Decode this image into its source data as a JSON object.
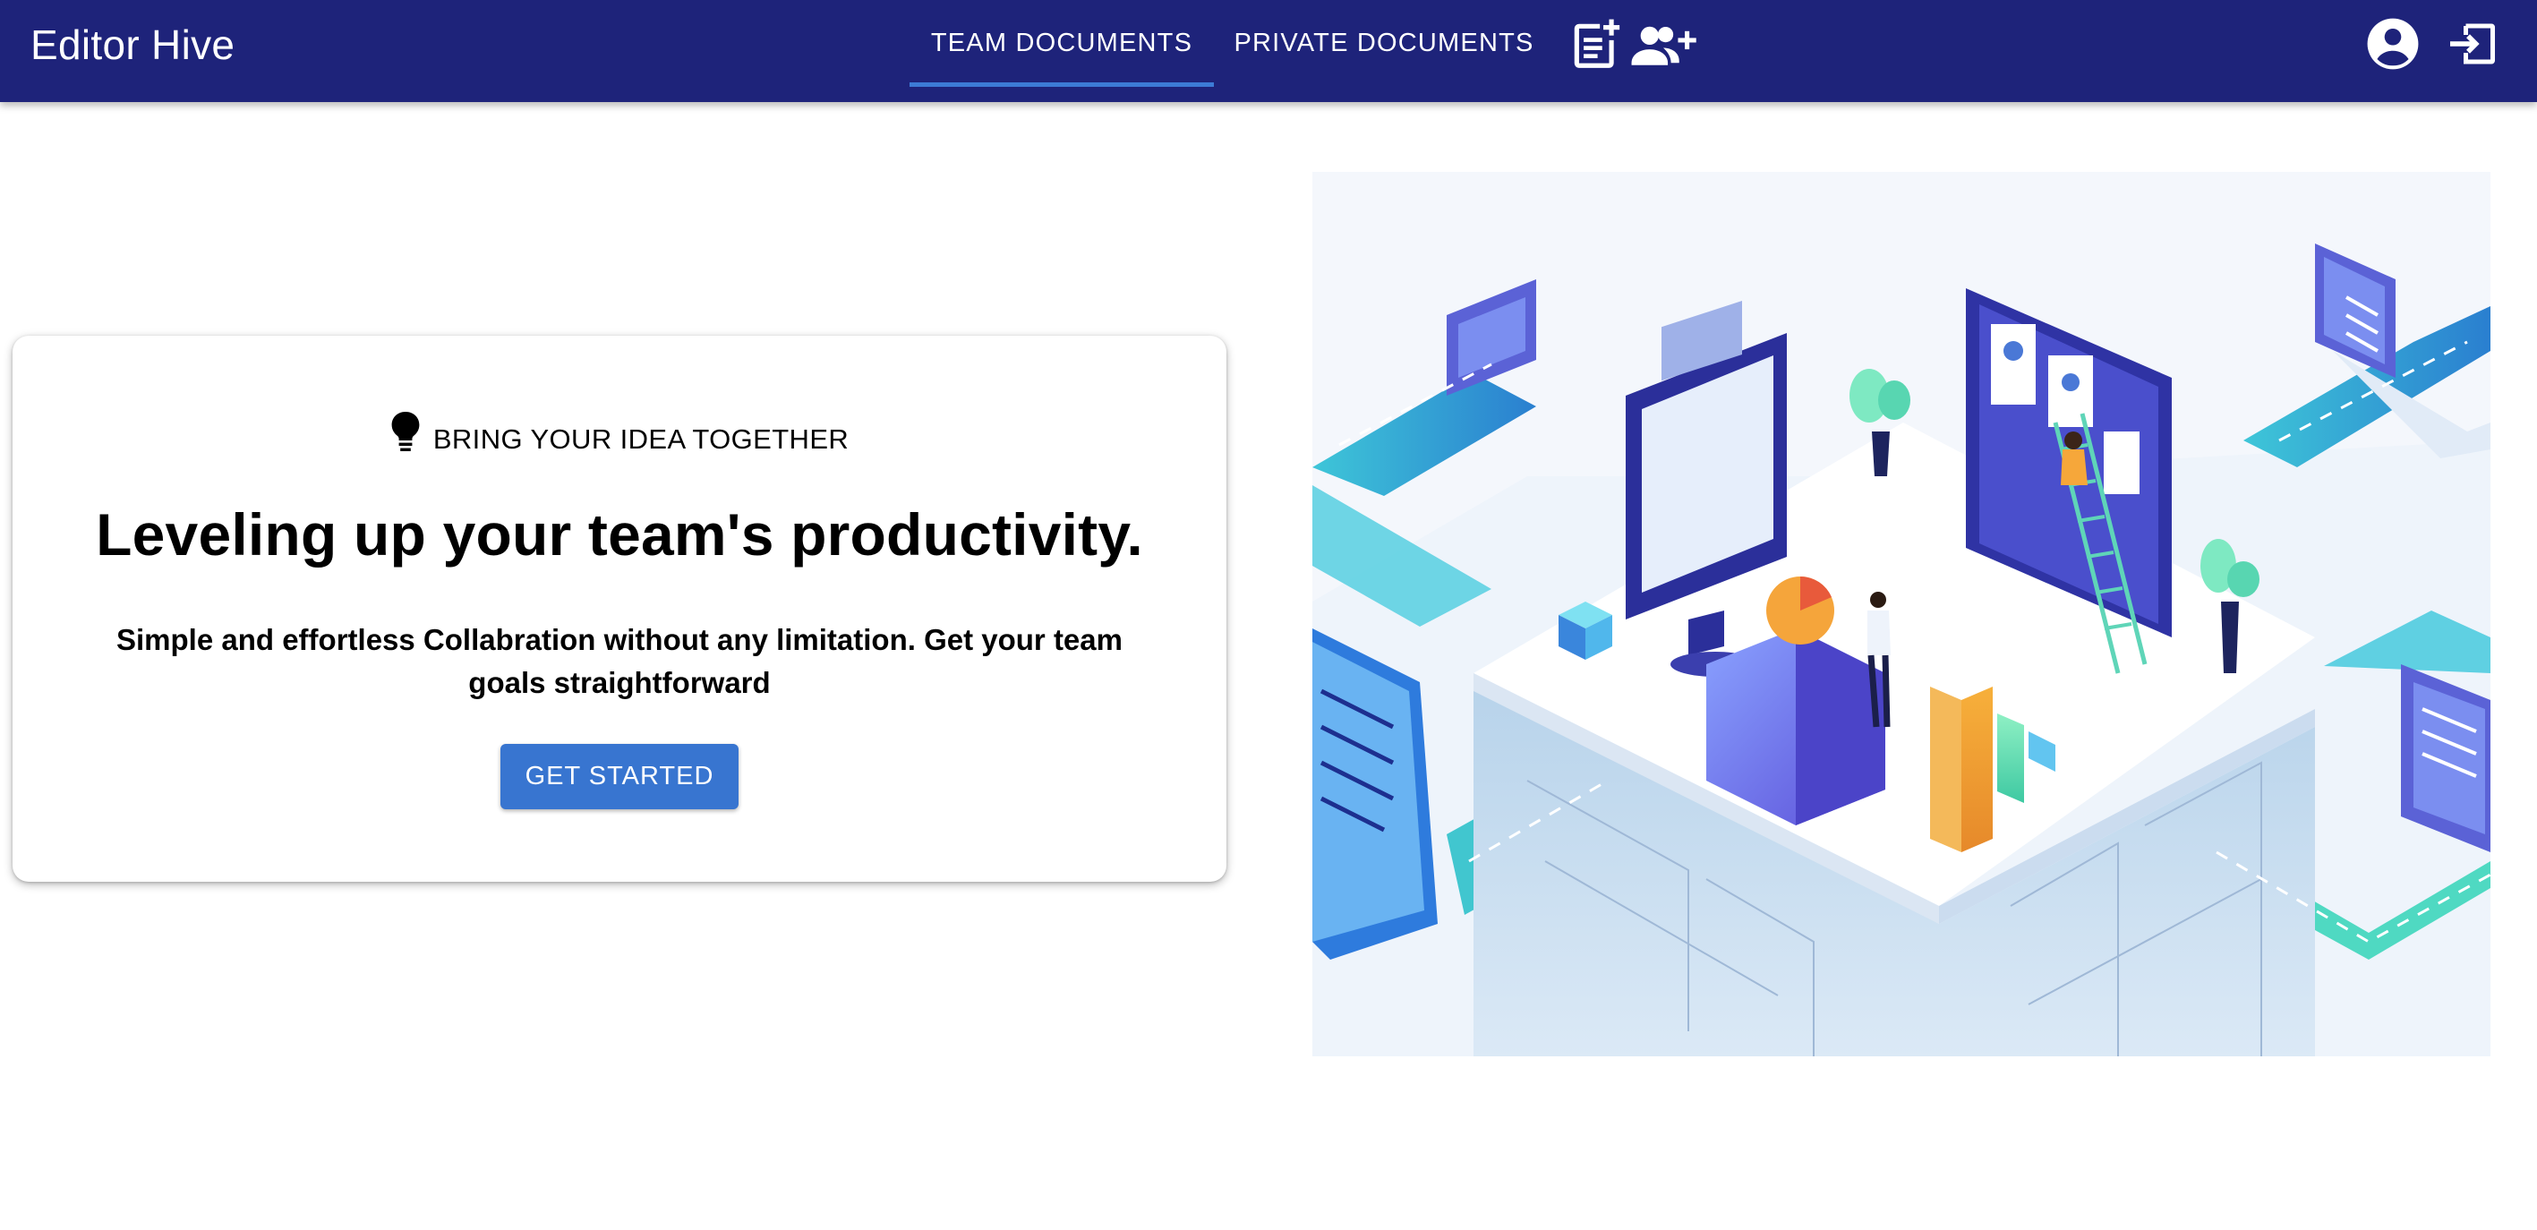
{
  "app": {
    "title": "Editor Hive"
  },
  "nav": {
    "tabs": [
      {
        "label": "TEAM DOCUMENTS",
        "active": true
      },
      {
        "label": "PRIVATE DOCUMENTS",
        "active": false
      }
    ],
    "icons": {
      "new_document": "note-add-icon",
      "add_member": "group-add-icon",
      "account": "account-circle-icon",
      "logout": "exit-to-app-icon"
    }
  },
  "hero": {
    "eyebrow_icon": "lightbulb-icon",
    "eyebrow": "BRING YOUR IDEA TOGETHER",
    "headline": "Leveling up your team's productivity.",
    "subtext": "Simple and effortless Collabration without any limitation. Get your team goals straightforward",
    "cta_label": "GET STARTED"
  },
  "colors": {
    "appbar": "#1e237a",
    "tab_indicator": "#3d7bd6",
    "cta": "#3875d0"
  }
}
